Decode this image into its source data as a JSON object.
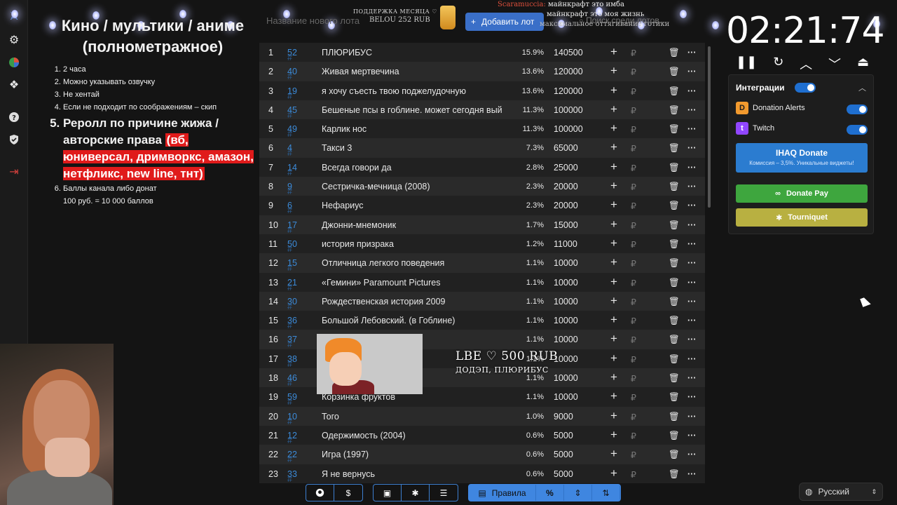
{
  "rules": {
    "title": "Кино / мультики / аниме (полнометражное)",
    "items": [
      "2 часа",
      "Можно указывать озвучку",
      "Не хентай",
      "Если не подходит по соображениям – скип"
    ],
    "big_item_prefix": "Реролл по причине жижа / авторские права",
    "big_item_highlight": "(вб, юниверсал, дримворкс, амазон, нетфликс, new line, тнт)",
    "item6_line1": "Баллы канала либо донат",
    "item6_line2": "100 руб. = 10 000 баллов"
  },
  "top": {
    "search_placeholder": "Название нового лота",
    "add_button": "Добавить лот",
    "search2": "Поиск среди лотов...",
    "donation_header": "ПОДДЕРЖКА МЕСЯЦА ♡",
    "donation_sub": "BELOU 252 RUB",
    "chat": [
      {
        "nick": "Scaramuccia:",
        "text": "майнкрафт это имба"
      },
      {
        "nick": "",
        "text": "майнкрафт это моя жизнь"
      },
      {
        "nick": "",
        "text": "максимальное оттягивание готики"
      }
    ]
  },
  "rows": [
    {
      "i": "1",
      "n": "52",
      "name": "ПЛЮРИБУС",
      "pct": "15.9%",
      "amt": "140500"
    },
    {
      "i": "2",
      "n": "40",
      "name": "Живая мертвечина",
      "pct": "13.6%",
      "amt": "120000"
    },
    {
      "i": "3",
      "n": "19",
      "name": "я хочу съесть твою поджелудочную",
      "pct": "13.6%",
      "amt": "120000"
    },
    {
      "i": "4",
      "n": "45",
      "name": "Бешеные псы в гоблине. может сегодня вый",
      "pct": "11.3%",
      "amt": "100000"
    },
    {
      "i": "5",
      "n": "49",
      "name": "Карлик нос",
      "pct": "11.3%",
      "amt": "100000"
    },
    {
      "i": "6",
      "n": "4",
      "name": "Такси 3",
      "pct": "7.3%",
      "amt": "65000"
    },
    {
      "i": "7",
      "n": "14",
      "name": "Всегда говори да",
      "pct": "2.8%",
      "amt": "25000"
    },
    {
      "i": "8",
      "n": "9",
      "name": "Сестричка-мечница (2008)",
      "pct": "2.3%",
      "amt": "20000"
    },
    {
      "i": "9",
      "n": "6",
      "name": "Нефариус",
      "pct": "2.3%",
      "amt": "20000"
    },
    {
      "i": "10",
      "n": "17",
      "name": "Джонни-мнемоник",
      "pct": "1.7%",
      "amt": "15000"
    },
    {
      "i": "11",
      "n": "50",
      "name": "история призрака",
      "pct": "1.2%",
      "amt": "11000"
    },
    {
      "i": "12",
      "n": "15",
      "name": "Отличница легкого поведения",
      "pct": "1.1%",
      "amt": "10000"
    },
    {
      "i": "13",
      "n": "21",
      "name": "«Гемини» Paramount Pictures",
      "pct": "1.1%",
      "amt": "10000"
    },
    {
      "i": "14",
      "n": "30",
      "name": "Рождественская история 2009",
      "pct": "1.1%",
      "amt": "10000"
    },
    {
      "i": "15",
      "n": "36",
      "name": "Большой Лебовский. (в Гоблине)",
      "pct": "1.1%",
      "amt": "10000"
    },
    {
      "i": "16",
      "n": "37",
      "name": "",
      "pct": "1.1%",
      "amt": "10000"
    },
    {
      "i": "17",
      "n": "38",
      "name": "",
      "pct": "1.1%",
      "amt": "10000"
    },
    {
      "i": "18",
      "n": "46",
      "name": "",
      "pct": "1.1%",
      "amt": "10000"
    },
    {
      "i": "19",
      "n": "59",
      "name": "Корзинка фруктов",
      "pct": "1.1%",
      "amt": "10000"
    },
    {
      "i": "20",
      "n": "10",
      "name": "Того",
      "pct": "1.0%",
      "amt": "9000"
    },
    {
      "i": "21",
      "n": "12",
      "name": "Одержимость (2004)",
      "pct": "0.6%",
      "amt": "5000"
    },
    {
      "i": "22",
      "n": "22",
      "name": "Игра (1997)",
      "pct": "0.6%",
      "amt": "5000"
    },
    {
      "i": "23",
      "n": "33",
      "name": "Я не вернусь",
      "pct": "0.6%",
      "amt": "5000"
    }
  ],
  "row_symbols": {
    "hash": "#",
    "plus": "+",
    "rub": "₽",
    "trash": "🗑",
    "more": "···"
  },
  "toolbar": {
    "rules_label": "Правила",
    "percent": "%"
  },
  "timer": "02:21:74",
  "integrations": {
    "title": "Интеграции",
    "services": [
      "Donation Alerts",
      "Twitch"
    ],
    "ihaq_title": "IHAQ Donate",
    "ihaq_sub": "Комиссия – 3,5%. Уникальные виджеты!",
    "donatepay": "Donate Pay",
    "tourniquet": "Tourniquet"
  },
  "language": "Русский",
  "donation_overlay": {
    "amount": "LBE ♡ 500 RUB",
    "message": "ДОДЭП, ПЛЮРИБУС"
  }
}
